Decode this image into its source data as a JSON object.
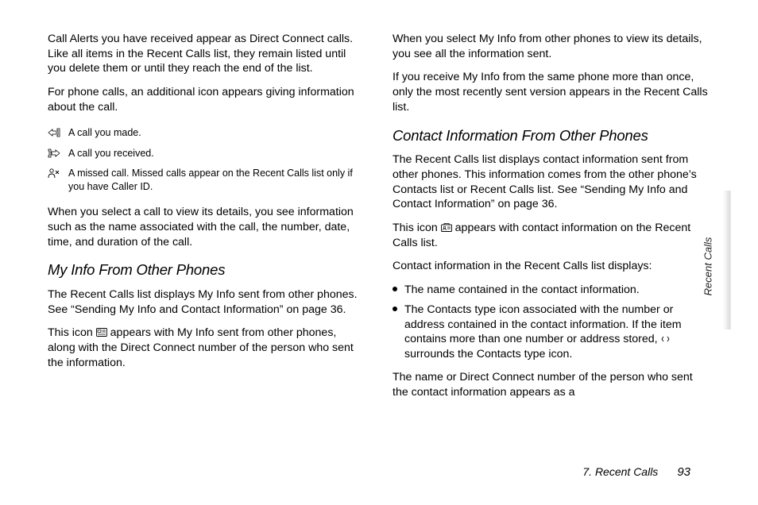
{
  "col1": {
    "p1": "Call Alerts you have received appear as Direct Connect calls. Like all items in the Recent Calls list, they remain listed until you delete them or until they reach the end of the list.",
    "p2": "For phone calls, an additional icon appears giving information about the call.",
    "icons": [
      {
        "name": "outgoing-call-icon",
        "desc": "A call you made."
      },
      {
        "name": "incoming-call-icon",
        "desc": "A call you received."
      },
      {
        "name": "missed-call-icon",
        "desc": "A missed call. Missed calls appear on the Recent Calls list only if you have Caller ID."
      }
    ],
    "p3": "When you select a call to view its details, you see information such as the name associated with the call, the number, date, time, and duration of the call.",
    "h1": "My Info From Other Phones",
    "p4": "The Recent Calls list displays My Info sent from other phones. See “Sending My Info and Contact Information” on page 36.",
    "p5a": "This icon ",
    "p5b": " appears with My Info sent from other phones, along with the Direct Connect number of the person who sent the information."
  },
  "col2": {
    "p1": "When you select My Info from other phones to view its details, you see all the information sent.",
    "p2": "If you receive My Info from the same phone more than once, only the most recently sent version appears in the Recent Calls list.",
    "h1": "Contact Information From Other Phones",
    "p3": "The Recent Calls list displays contact information sent from other phones. This information comes from the other phone’s Contacts list or Recent Calls list. See “Sending My Info and Contact Information” on page 36.",
    "p4a": "This icon ",
    "p4b": " appears with contact information on the Recent Calls list.",
    "p5": "Contact information in the Recent Calls list displays:",
    "bullets": [
      "The name contained in the contact information.",
      "The Contacts type icon associated with the number or address contained in the contact information. If the item contains more than one number or address stored, __ICON__ surrounds the Contacts type icon."
    ],
    "p6": "The name or Direct Connect number of the person who sent the contact information appears as a"
  },
  "side_tab": "Recent Calls",
  "footer_chapter": "7. Recent Calls",
  "footer_page": "93"
}
